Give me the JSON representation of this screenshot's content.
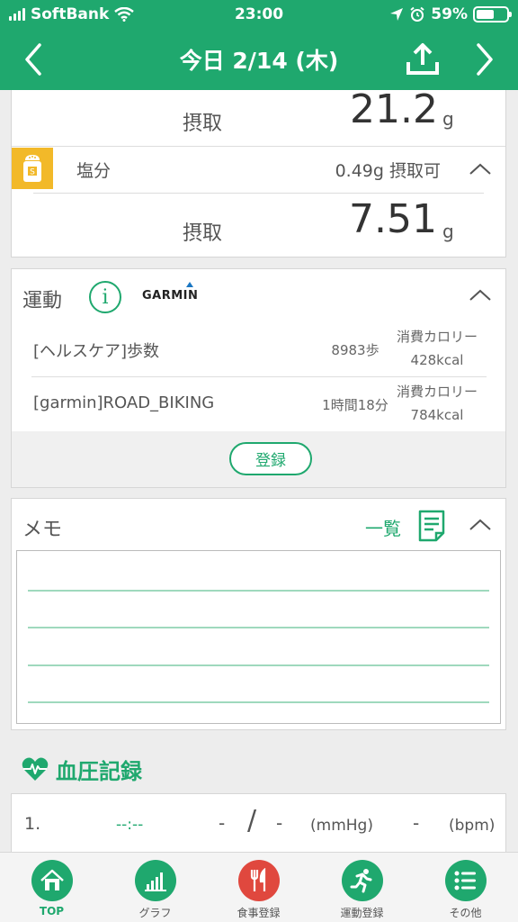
{
  "status_bar": {
    "carrier": "SoftBank",
    "time": "23:00",
    "battery": "59%",
    "battery_level": 0.59
  },
  "nav": {
    "title": "今日 2/14 (木)"
  },
  "nutrition": {
    "prev_item": {
      "intake_label": "摂取",
      "intake_value": "21.2",
      "intake_unit": "g"
    },
    "salt": {
      "icon_letter": "S",
      "name": "塩分",
      "status": "0.49g 摂取可",
      "intake_label": "摂取",
      "intake_value": "7.51",
      "intake_unit": "g"
    }
  },
  "exercise": {
    "title": "運動",
    "info_glyph": "i",
    "garmin_logo": "GARMIN",
    "rows": [
      {
        "name": "[ヘルスケア]歩数",
        "amount": "8983歩",
        "cal_label": "消費カロリー",
        "cal_value": "428kcal"
      },
      {
        "name": "[garmin]ROAD_BIKING",
        "amount": "1時間18分",
        "cal_label": "消費カロリー",
        "cal_value": "784kcal"
      }
    ],
    "register_label": "登録"
  },
  "memo": {
    "title": "メモ",
    "list_label": "一覧"
  },
  "blood_pressure": {
    "title": "血圧記録",
    "row": {
      "num": "1.",
      "time": "--:--",
      "systolic": "-",
      "slash": "/",
      "diastolic": "-",
      "unit_pressure": "(mmHg)",
      "pulse": "-",
      "unit_pulse": "(bpm)"
    }
  },
  "tabbar": {
    "tabs": [
      {
        "label": "TOP",
        "icon": "home-icon"
      },
      {
        "label": "グラフ",
        "icon": "bar-chart-icon"
      },
      {
        "label": "食事登録",
        "icon": "fork-knife-icon"
      },
      {
        "label": "運動登録",
        "icon": "runner-icon"
      },
      {
        "label": "その他",
        "icon": "list-icon"
      }
    ],
    "active": "TOP"
  },
  "colors": {
    "brand_green": "#1fa86e",
    "salt_yellow": "#f2b929",
    "meal_red": "#e0483e"
  }
}
